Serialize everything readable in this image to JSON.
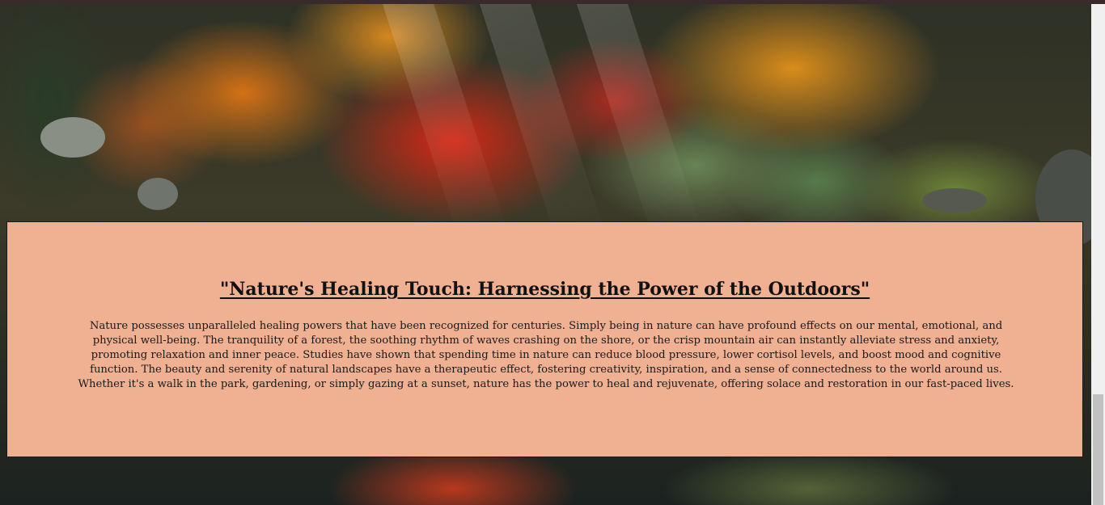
{
  "article": {
    "title": "\"Nature's Healing Touch: Harnessing the Power of the Outdoors\"",
    "body": "Nature possesses unparalleled healing powers that have been recognized for centuries. Simply being in nature can have profound effects on our mental, emotional, and physical well-being. The tranquility of a forest, the soothing rhythm of waves crashing on the shore, or the crisp mountain air can instantly alleviate stress and anxiety, promoting relaxation and inner peace. Studies have shown that spending time in nature can reduce blood pressure, lower cortisol levels, and boost mood and cognitive function. The beauty and serenity of natural landscapes have a therapeutic effect, fostering creativity, inspiration, and a sense of connectedness to the world around us. Whether it's a walk in the park, gardening, or simply gazing at a sunset, nature has the power to heal and rejuvenate, offering solace and restoration in our fast-paced lives."
  },
  "colors": {
    "card_background": "#f0b092",
    "card_border": "#1a1a1a",
    "text": "#111111",
    "top_bar": "#3a2a2c",
    "scrollbar_track": "#f0f0f0",
    "scrollbar_thumb": "#c1c1c1"
  },
  "background": {
    "icon": "autumn-garden-photo"
  }
}
